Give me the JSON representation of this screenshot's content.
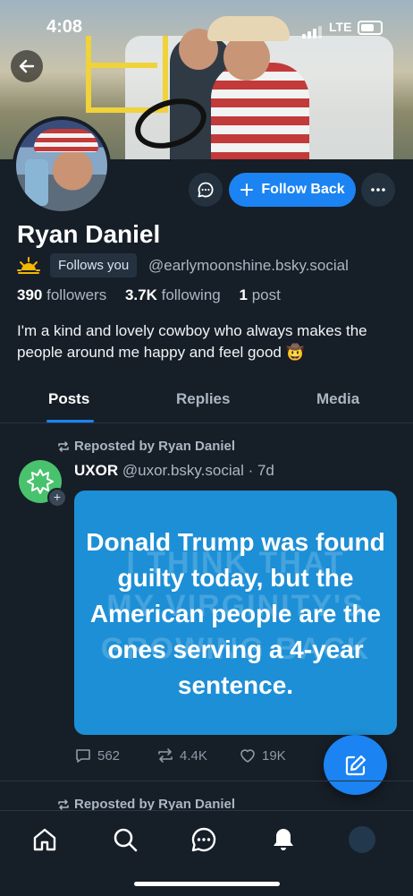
{
  "status_bar": {
    "time": "4:08",
    "network": "LTE"
  },
  "profile": {
    "name": "Ryan Daniel",
    "follows_you_badge": "Follows you",
    "handle": "@earlymoonshine.bsky.social",
    "followers_count": "390",
    "followers_label": "followers",
    "following_count": "3.7K",
    "following_label": "following",
    "posts_count": "1",
    "posts_label": "post",
    "bio": "I'm a kind and lovely cowboy who always makes the people around me happy and feel good 🤠",
    "follow_back_label": "Follow Back"
  },
  "tabs": [
    {
      "label": "Posts",
      "active": true
    },
    {
      "label": "Replies",
      "active": false
    },
    {
      "label": "Media",
      "active": false
    }
  ],
  "feed": [
    {
      "repost_label": "Reposted by Ryan Daniel",
      "author_name": "UXOR",
      "author_handle": "@uxor.bsky.social",
      "age": "· 7d",
      "image_text": "Donald Trump was found guilty today, but the American people are the ones serving a 4-year sentence.",
      "image_background_text": [
        "I THINK THAT",
        "MY VIRGINITY'S",
        "GROWING BACK"
      ],
      "replies": "562",
      "reposts": "4.4K",
      "likes": "19K"
    },
    {
      "repost_label": "Reposted by Ryan Daniel"
    }
  ],
  "colors": {
    "accent": "#1b83f2",
    "background": "#161e27",
    "secondary_text": "#aab7c4",
    "avatar_green": "#49c26e"
  },
  "icons": [
    "back-arrow-icon",
    "chat-bubble-icon",
    "plus-icon",
    "more-dots-icon",
    "sun-icon",
    "repost-icon",
    "reply-icon",
    "like-icon",
    "compose-icon",
    "home-icon",
    "search-icon",
    "messages-icon",
    "bell-icon"
  ]
}
